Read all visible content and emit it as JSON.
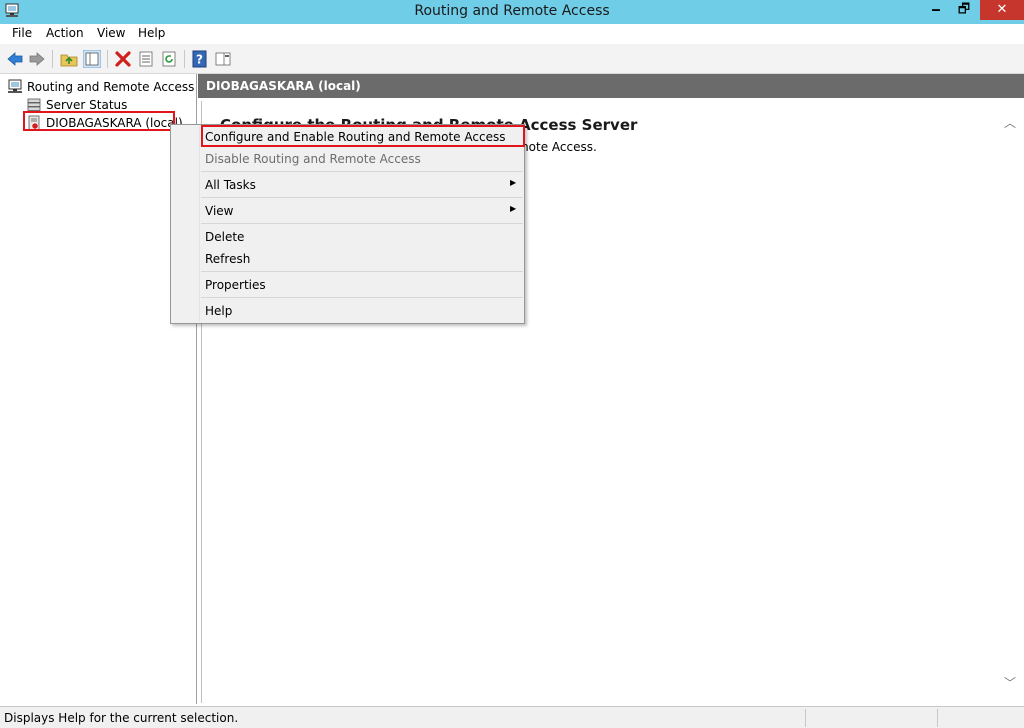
{
  "window": {
    "title": "Routing and Remote Access",
    "minimize_glyph": "🗕",
    "maximize_glyph": "🗗",
    "close_glyph": "✕"
  },
  "menu": {
    "file": "File",
    "action": "Action",
    "view": "View",
    "help": "Help"
  },
  "toolbar": {
    "icons": [
      "back-arrow-icon",
      "forward-arrow-icon",
      "up-folder-icon",
      "show-hide-tree-icon",
      "delete-icon",
      "properties-icon",
      "refresh-icon",
      "help-icon",
      "action-pane-icon"
    ]
  },
  "tree": {
    "root": "Routing and Remote Access",
    "server_status": "Server Status",
    "server": "DIOBAGASKARA (local)"
  },
  "right_pane": {
    "header": "DIOBAGASKARA (local)",
    "title": "Configure the Routing and Remote Access Server",
    "text": "menu, click Configure and Enable Routing and Remote Access."
  },
  "context_menu": {
    "configure": "Configure and Enable Routing and Remote Access",
    "disable": "Disable Routing and Remote Access",
    "all_tasks": "All Tasks",
    "view": "View",
    "delete": "Delete",
    "refresh": "Refresh",
    "properties": "Properties",
    "help": "Help",
    "submenu_arrow": "▶"
  },
  "status": {
    "text": "Displays Help for the current selection."
  },
  "colors": {
    "titlebar": "#6fcde8",
    "highlight_box": "#e0161c",
    "header_bar": "#6b6b6b"
  }
}
